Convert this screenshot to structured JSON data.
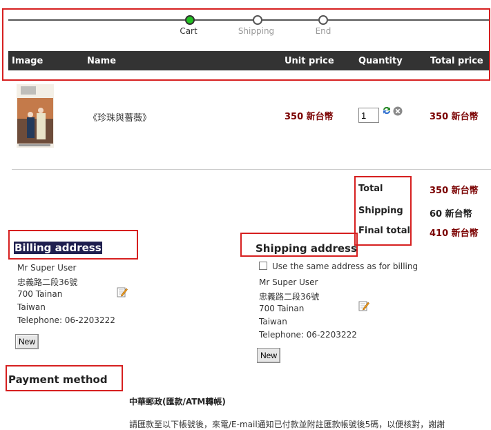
{
  "steps": [
    {
      "label": "Cart",
      "active": true
    },
    {
      "label": "Shipping",
      "active": false
    },
    {
      "label": "End",
      "active": false
    }
  ],
  "table": {
    "headers": [
      "Image",
      "Name",
      "Unit price",
      "Quantity",
      "Total price"
    ],
    "row": {
      "name": "《珍珠與薔薇》",
      "unit_price": "350 新台幣",
      "quantity": "1",
      "total_price": "350 新台幣"
    }
  },
  "totals": {
    "total_label": "Total",
    "total_value": "350 新台幣",
    "shipping_label": "Shipping",
    "shipping_value": "60 新台幣",
    "final_label": "Final total",
    "final_value": "410 新台幣"
  },
  "billing": {
    "heading": "Billing address",
    "lines": [
      "Mr Super User",
      "忠義路二段36號",
      "700 Tainan",
      "Taiwan",
      "Telephone: 06-2203222"
    ],
    "new_button": "New"
  },
  "shipping": {
    "heading": "Shipping address",
    "same_as_billing": "Use the same address as for billing",
    "lines": [
      "Mr Super User",
      "忠義路二段36號",
      "700 Tainan",
      "Taiwan",
      "Telephone: 06-2203222"
    ],
    "new_button": "New"
  },
  "payment": {
    "heading": "Payment method",
    "option_title": "中華郵政(匯款/ATM轉帳)",
    "option_desc": "請匯款至以下帳號後，來電/E-mail通知已付款並附註匯款帳號後5碼，以便核對，謝謝"
  },
  "colors": {
    "accent_red": "#d61f1f",
    "price_red": "#7a0000",
    "header_bg": "#333333",
    "active_step": "#23c223"
  },
  "icons": [
    "refresh-icon",
    "remove-icon",
    "edit-icon"
  ]
}
